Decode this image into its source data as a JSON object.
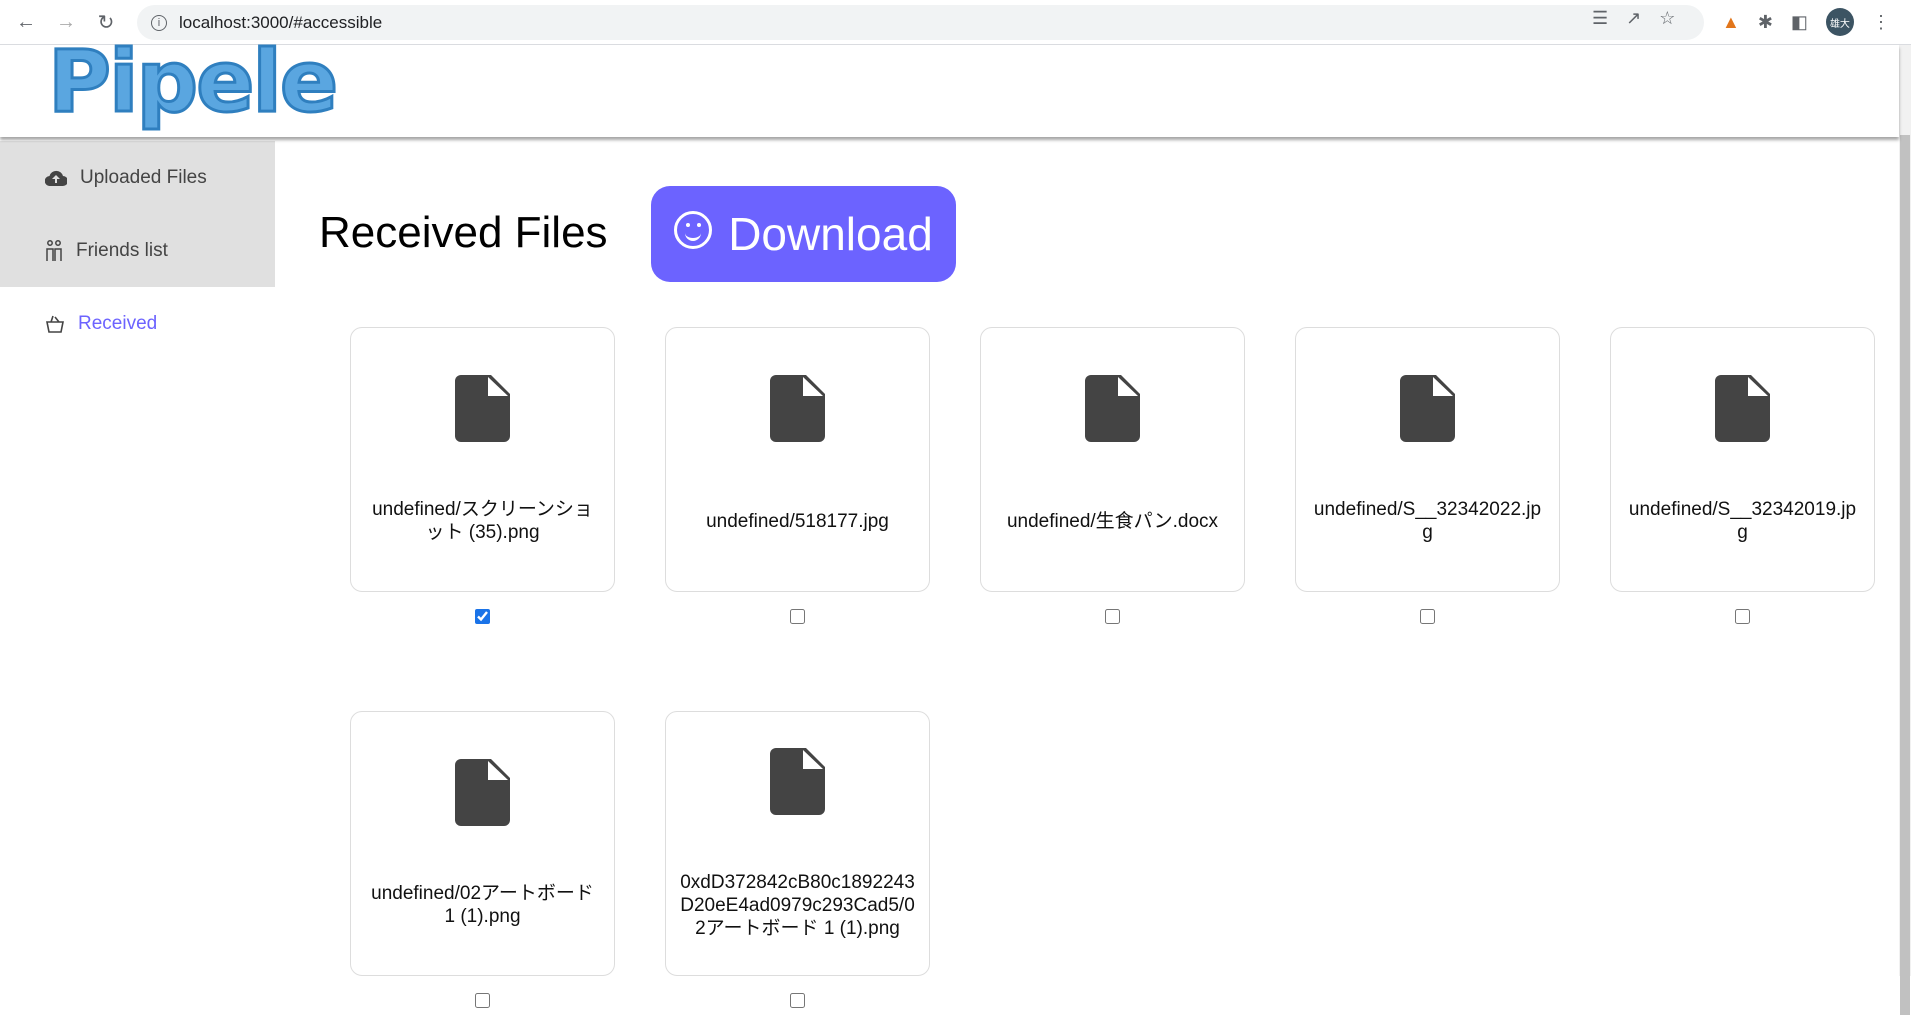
{
  "browser": {
    "url": "localhost:3000/#accessible",
    "avatar_text": "雄大"
  },
  "app": {
    "logo": "Pipele",
    "accent": "#6c63ff"
  },
  "sidebar": {
    "items": [
      {
        "label": "Uploaded Files",
        "icon": "cloud-upload-icon"
      },
      {
        "label": "Friends list",
        "icon": "people-icon"
      },
      {
        "label": "Received",
        "icon": "basket-icon",
        "active": true
      }
    ]
  },
  "main": {
    "title": "Received Files",
    "download_label": "Download",
    "files": [
      {
        "name": "undefined/スクリーンショット (35).png",
        "checked": true
      },
      {
        "name": "undefined/518177.jpg",
        "checked": false
      },
      {
        "name": "undefined/生食パン.docx",
        "checked": false
      },
      {
        "name": "undefined/S__32342022.jpg",
        "checked": false
      },
      {
        "name": "undefined/S__32342019.jpg",
        "checked": false
      },
      {
        "name": "undefined/02アートボード 1 (1).png",
        "checked": false
      },
      {
        "name": "0xdD372842cB80c1892243D20eE4ad0979c293Cad5/02アートボード 1 (1).png",
        "checked": false
      }
    ]
  }
}
